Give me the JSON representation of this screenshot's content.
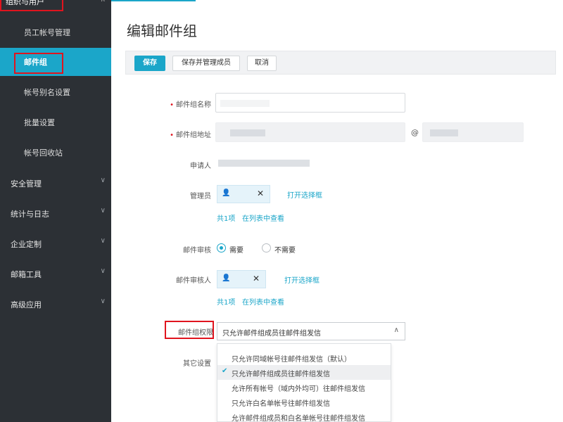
{
  "sidebar": {
    "top_group": "组织与用户",
    "sub_items": [
      "员工帐号管理",
      "邮件组",
      "帐号别名设置",
      "批量设置",
      "帐号回收站"
    ],
    "groups": [
      "安全管理",
      "统计与日志",
      "企业定制",
      "邮箱工具",
      "高级应用"
    ]
  },
  "page": {
    "title": "编辑邮件组"
  },
  "toolbar": {
    "save": "保存",
    "save_manage": "保存并管理成员",
    "cancel": "取消"
  },
  "form": {
    "group_name": "邮件组名称",
    "group_address": "邮件组地址",
    "at_sign": "@",
    "applicant": "申请人",
    "admin": "管理员",
    "open_selector": "打开选择框",
    "count": "共1项",
    "view_in_list": "在列表中查看",
    "review": "邮件审核",
    "need": "需要",
    "no_need": "不需要",
    "reviewer": "邮件审核人",
    "permission": "邮件组权限",
    "permission_value": "只允许邮件组成员往邮件组发信",
    "other": "其它设置"
  },
  "dropdown_options": [
    "只允许同域帐号往邮件组发信（默认）",
    "只允许邮件组成员往邮件组发信",
    "允许所有帐号（域内外均可）往邮件组发信",
    "只允许白名单帐号往邮件组发信",
    "允许邮件组成员和白名单帐号往邮件组发信"
  ],
  "colors": {
    "accent": "#1ba6c9",
    "sidebar": "#2c3035",
    "highlight": "#e0141e"
  }
}
